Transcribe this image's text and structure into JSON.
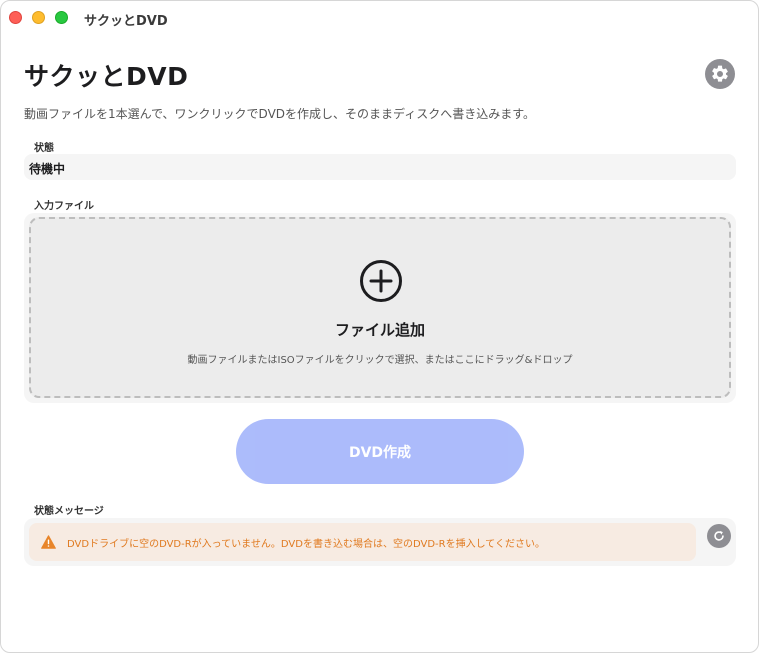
{
  "window": {
    "title": "サクッとDVD"
  },
  "header": {
    "title": "サクッとDVD",
    "settings_icon": "gear-icon",
    "description": "動画ファイルを1本選んで、ワンクリックでDVDを作成し、そのままディスクへ書き込みます。"
  },
  "status": {
    "label": "状態",
    "value": "待機中"
  },
  "input_file": {
    "label": "入力ファイル",
    "icon": "plus-circle-icon",
    "title": "ファイル追加",
    "subtitle": "動画ファイルまたはISOファイルをクリックで選択、またはここにドラッグ&ドロップ"
  },
  "create_button": {
    "label": "DVD作成",
    "enabled": false,
    "color": "#a8b8fb"
  },
  "status_message": {
    "label": "状態メッセージ",
    "icon": "warning-icon",
    "text": "DVDドライブに空のDVD-Rが入っていません。DVDを書き込む場合は、空のDVD-Rを挿入してください。",
    "text_color": "#e07a20",
    "background_color": "#f7ebe2",
    "refresh_icon": "refresh-icon"
  }
}
